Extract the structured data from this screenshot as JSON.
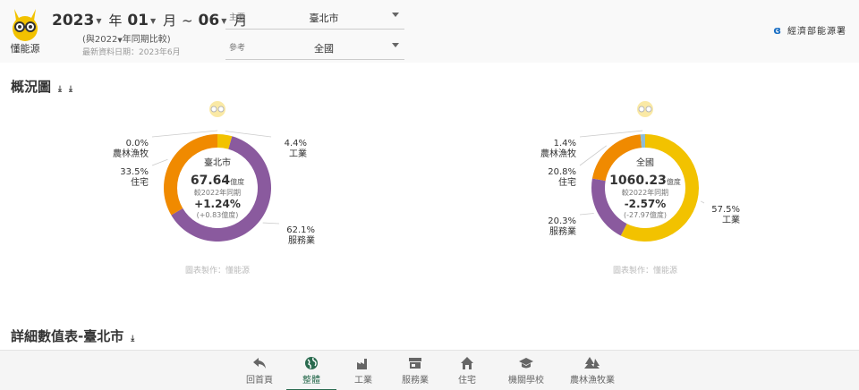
{
  "header": {
    "logo_label": "懂能源",
    "period": {
      "year": "2023",
      "year_unit": "年",
      "start_month": "01",
      "month_unit": "月",
      "separator": "~",
      "end_month": "06",
      "end_unit": "月"
    },
    "compare": {
      "prefix": "(與",
      "year": "2022",
      "suffix": "年同期比較)"
    },
    "updated": "最新資料日期：2023年6月",
    "primary": {
      "label": "主要",
      "value": "臺北市"
    },
    "reference": {
      "label": "參考",
      "value": "全國"
    },
    "brand": "經濟部能源署"
  },
  "overview": {
    "title": "概況圖"
  },
  "detail": {
    "title": "詳細數值表-臺北市"
  },
  "colors": {
    "agriculture": "#8fbcd4",
    "industry": "#f2c200",
    "services": "#8a5a9e",
    "residential": "#f08a00"
  },
  "chart_data": [
    {
      "type": "pie",
      "center_name": "臺北市",
      "total_value": "67.64",
      "total_unit": "億度",
      "compare_label": "較2022年同期",
      "change_pct": "+1.24%",
      "change_abs": "(+0.83億度)",
      "credit": "圖表製作：懂能源",
      "slices": [
        {
          "label": "工業",
          "value": 4.4,
          "pct_text": "4.4%"
        },
        {
          "label": "服務業",
          "value": 62.1,
          "pct_text": "62.1%"
        },
        {
          "label": "住宅",
          "value": 33.5,
          "pct_text": "33.5%"
        },
        {
          "label": "農林漁牧",
          "value": 0.0,
          "pct_text": "0.0%"
        }
      ]
    },
    {
      "type": "pie",
      "center_name": "全國",
      "total_value": "1060.23",
      "total_unit": "億度",
      "compare_label": "較2022年同期",
      "change_pct": "-2.57%",
      "change_abs": "(-27.97億度)",
      "credit": "圖表製作：懂能源",
      "slices": [
        {
          "label": "工業",
          "value": 57.5,
          "pct_text": "57.5%"
        },
        {
          "label": "服務業",
          "value": 20.3,
          "pct_text": "20.3%"
        },
        {
          "label": "住宅",
          "value": 20.8,
          "pct_text": "20.8%"
        },
        {
          "label": "農林漁牧",
          "value": 1.4,
          "pct_text": "1.4%"
        }
      ]
    }
  ],
  "nav": [
    {
      "label": "回首頁",
      "icon": "back-arrow-icon"
    },
    {
      "label": "整體",
      "icon": "globe-icon"
    },
    {
      "label": "工業",
      "icon": "factory-icon"
    },
    {
      "label": "服務業",
      "icon": "store-icon"
    },
    {
      "label": "住宅",
      "icon": "house-icon"
    },
    {
      "label": "機關學校",
      "icon": "school-cap-icon"
    },
    {
      "label": "農林漁牧業",
      "icon": "trees-icon"
    }
  ]
}
